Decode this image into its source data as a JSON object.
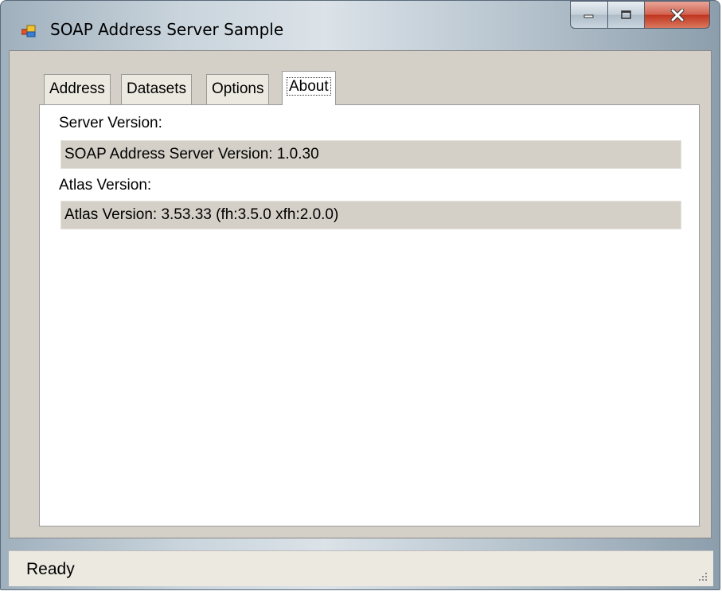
{
  "window": {
    "title": "SOAP Address Server Sample",
    "controls": {
      "minimize": "minimize-icon",
      "maximize": "maximize-icon",
      "close": "close-icon"
    }
  },
  "tabs": [
    {
      "label": "Address",
      "active": false
    },
    {
      "label": "Datasets",
      "active": false
    },
    {
      "label": "Options",
      "active": false
    },
    {
      "label": "About",
      "active": true
    }
  ],
  "about": {
    "server_version_label": "Server Version:",
    "server_version_value": "SOAP Address Server Version: 1.0.30",
    "atlas_version_label": "Atlas Version:",
    "atlas_version_value": "Atlas Version: 3.53.33 (fh:3.5.0 xfh:2.0.0)"
  },
  "status": {
    "text": "Ready"
  },
  "colors": {
    "close_button": "#c0341d",
    "panel_background": "#ffffff",
    "dialog_background": "#d4d0c8"
  }
}
